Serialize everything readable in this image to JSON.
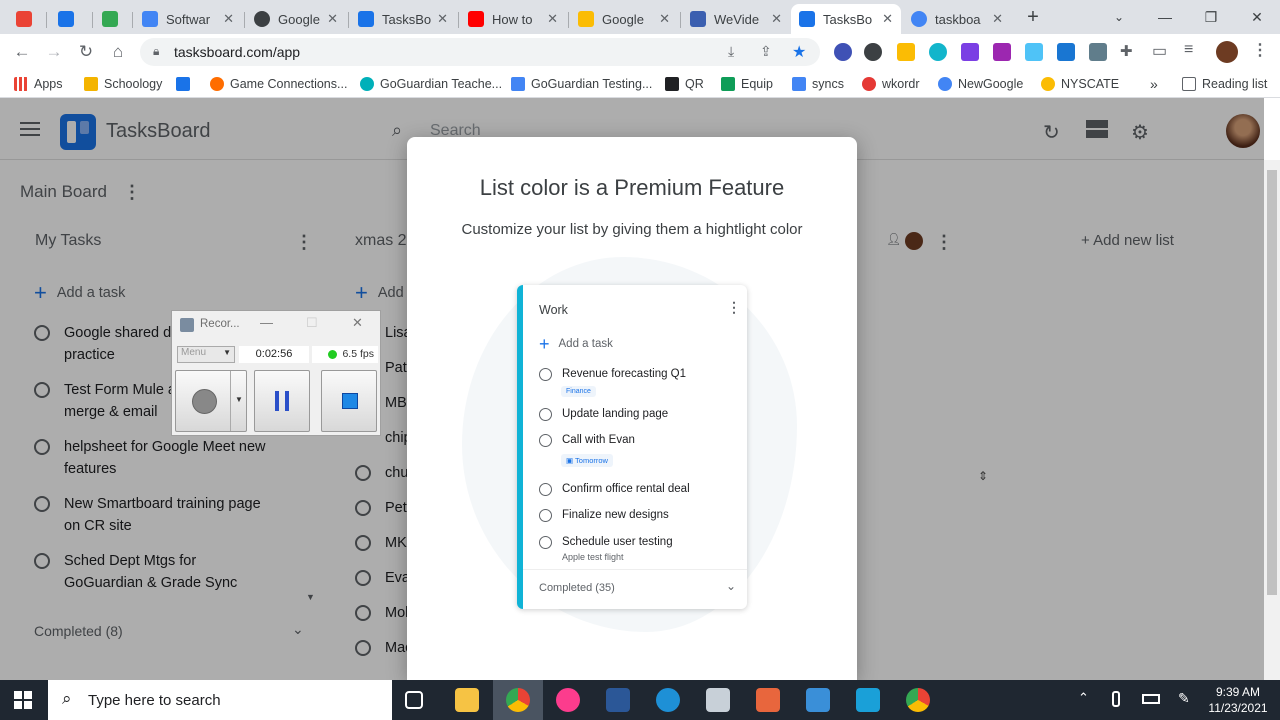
{
  "browser": {
    "tabs": [
      {
        "title": "",
        "color": "#ea4335"
      },
      {
        "title": "",
        "color": "#1a73e8"
      },
      {
        "title": "",
        "color": "#34a853"
      },
      {
        "title": "Softwar",
        "color": "#4285f4"
      },
      {
        "title": "Google",
        "color": "#3c4043"
      },
      {
        "title": "TasksBo",
        "color": "#1a73e8"
      },
      {
        "title": "How to",
        "color": "#ff0000"
      },
      {
        "title": "Google",
        "color": "#fbbc04"
      },
      {
        "title": "WeVide",
        "color": "#3b5fb0"
      },
      {
        "title": "TasksBo",
        "color": "#1a73e8"
      },
      {
        "title": "taskboa",
        "color": "#4285f4"
      }
    ],
    "url": "tasksboard.com/app",
    "bookmarks": [
      "Apps",
      "Schoology",
      "",
      "Game Connections...",
      "GoGuardian Teache...",
      "GoGuardian Testing...",
      "QR",
      "Equip",
      "syncs",
      "wkordr",
      "NewGoogle",
      "NYSCATE"
    ],
    "reading_list": "Reading list",
    "more_bookmarks": "»"
  },
  "app": {
    "name": "TasksBoard",
    "search_placeholder": "Search",
    "board_title": "Main Board",
    "add_new_list": "+ Add new list",
    "lists": [
      {
        "name": "My Tasks",
        "add_task": "Add a task",
        "tasks": [
          "Google shared dr practice",
          "Test Form Mule a merge & email",
          "helpsheet for Google Meet new features",
          "New Smartboard training page on CR site",
          "Sched Dept Mtgs for GoGuardian & Grade Sync"
        ],
        "completed": "Completed (8)"
      },
      {
        "name": "xmas 2",
        "add_task": "Add",
        "tasks": [
          "Lisa",
          "Pat",
          "MB",
          "chip",
          "chu",
          "Pete",
          "MK",
          "Eva",
          "Moh",
          "Mac"
        ]
      }
    ]
  },
  "modal": {
    "title": "List color is a Premium Feature",
    "subtitle": "Customize your list by giving them a hightlight color",
    "accent_color": "#10b3d6",
    "sample": {
      "list_name": "Work",
      "add_task": "Add a task",
      "tasks": [
        {
          "title": "Revenue forecasting Q1",
          "tag": "Finance"
        },
        {
          "title": "Update landing page"
        },
        {
          "title": "Call with Evan",
          "tag": "Tomorrow"
        },
        {
          "title": "Confirm office rental deal"
        },
        {
          "title": "Finalize new designs"
        },
        {
          "title": "Schedule user testing",
          "note": "Apple test flight"
        }
      ],
      "completed": "Completed (35)"
    }
  },
  "recorder": {
    "title": "Recor...",
    "menu": "Menu",
    "time": "0:02:56",
    "fps": "6.5 fps"
  },
  "taskbar": {
    "search_placeholder": "Type here to search",
    "time": "9:39 AM",
    "date": "11/23/2021"
  }
}
